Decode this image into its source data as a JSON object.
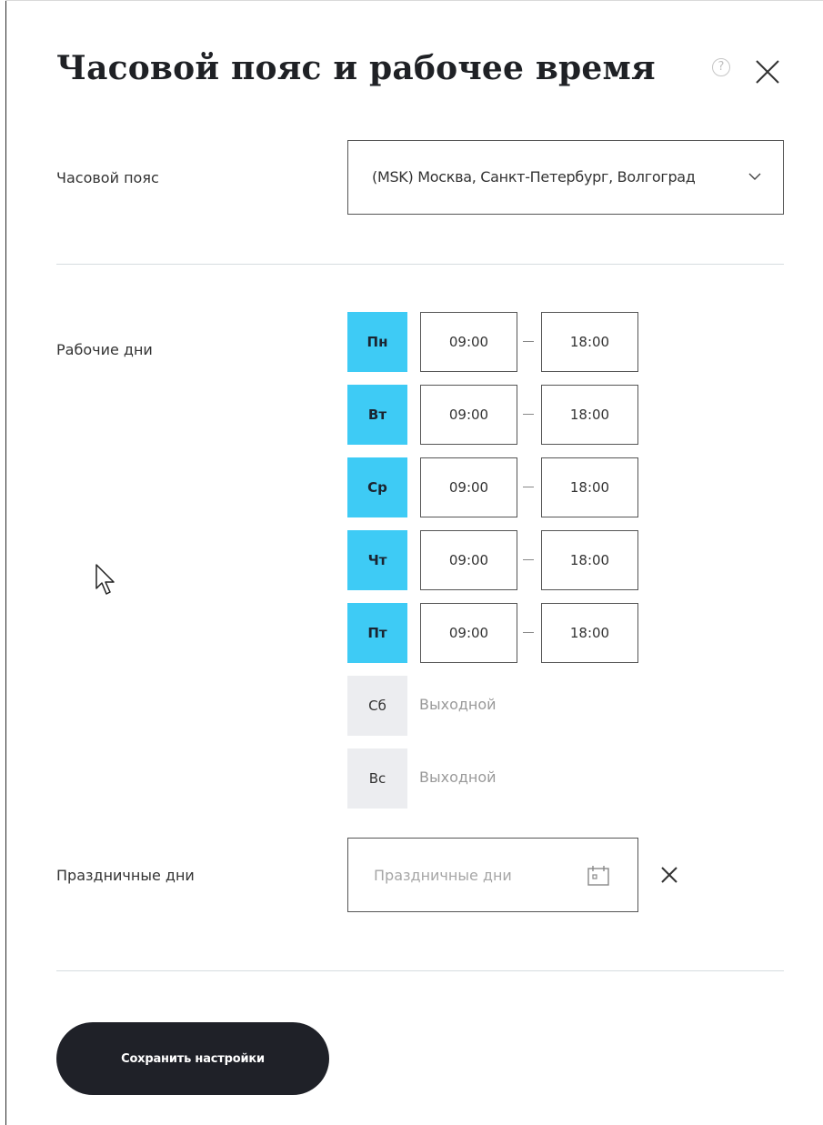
{
  "dialog": {
    "title": "Часовой пояс и рабочее время",
    "help_icon": "help-circle-icon",
    "help_glyph": "?",
    "close_icon": "close-icon"
  },
  "timezone": {
    "label": "Часовой пояс",
    "value": "(MSK) Москва, Санкт-Петербург, Волгоград",
    "chevron_icon": "chevron-down-icon"
  },
  "workdays": {
    "label": "Рабочие дни",
    "days": [
      {
        "short": "Пн",
        "active": true,
        "from": "09:00",
        "to": "18:00"
      },
      {
        "short": "Вт",
        "active": true,
        "from": "09:00",
        "to": "18:00"
      },
      {
        "short": "Ср",
        "active": true,
        "from": "09:00",
        "to": "18:00"
      },
      {
        "short": "Чт",
        "active": true,
        "from": "09:00",
        "to": "18:00"
      },
      {
        "short": "Пт",
        "active": true,
        "from": "09:00",
        "to": "18:00"
      },
      {
        "short": "Сб",
        "active": false,
        "off_text": "Выходной"
      },
      {
        "short": "Вс",
        "active": false,
        "off_text": "Выходной"
      }
    ]
  },
  "holidays": {
    "label": "Праздничные дни",
    "placeholder": "Праздничные дни",
    "value": "",
    "calendar_icon": "calendar-icon",
    "clear_icon": "clear-icon"
  },
  "actions": {
    "save_label": "Сохранить настройки"
  },
  "colors": {
    "active_day": "#3ecbf5",
    "inactive_day": "#ecedf0",
    "primary_button": "#1f2128",
    "divider": "#d6dde0"
  }
}
